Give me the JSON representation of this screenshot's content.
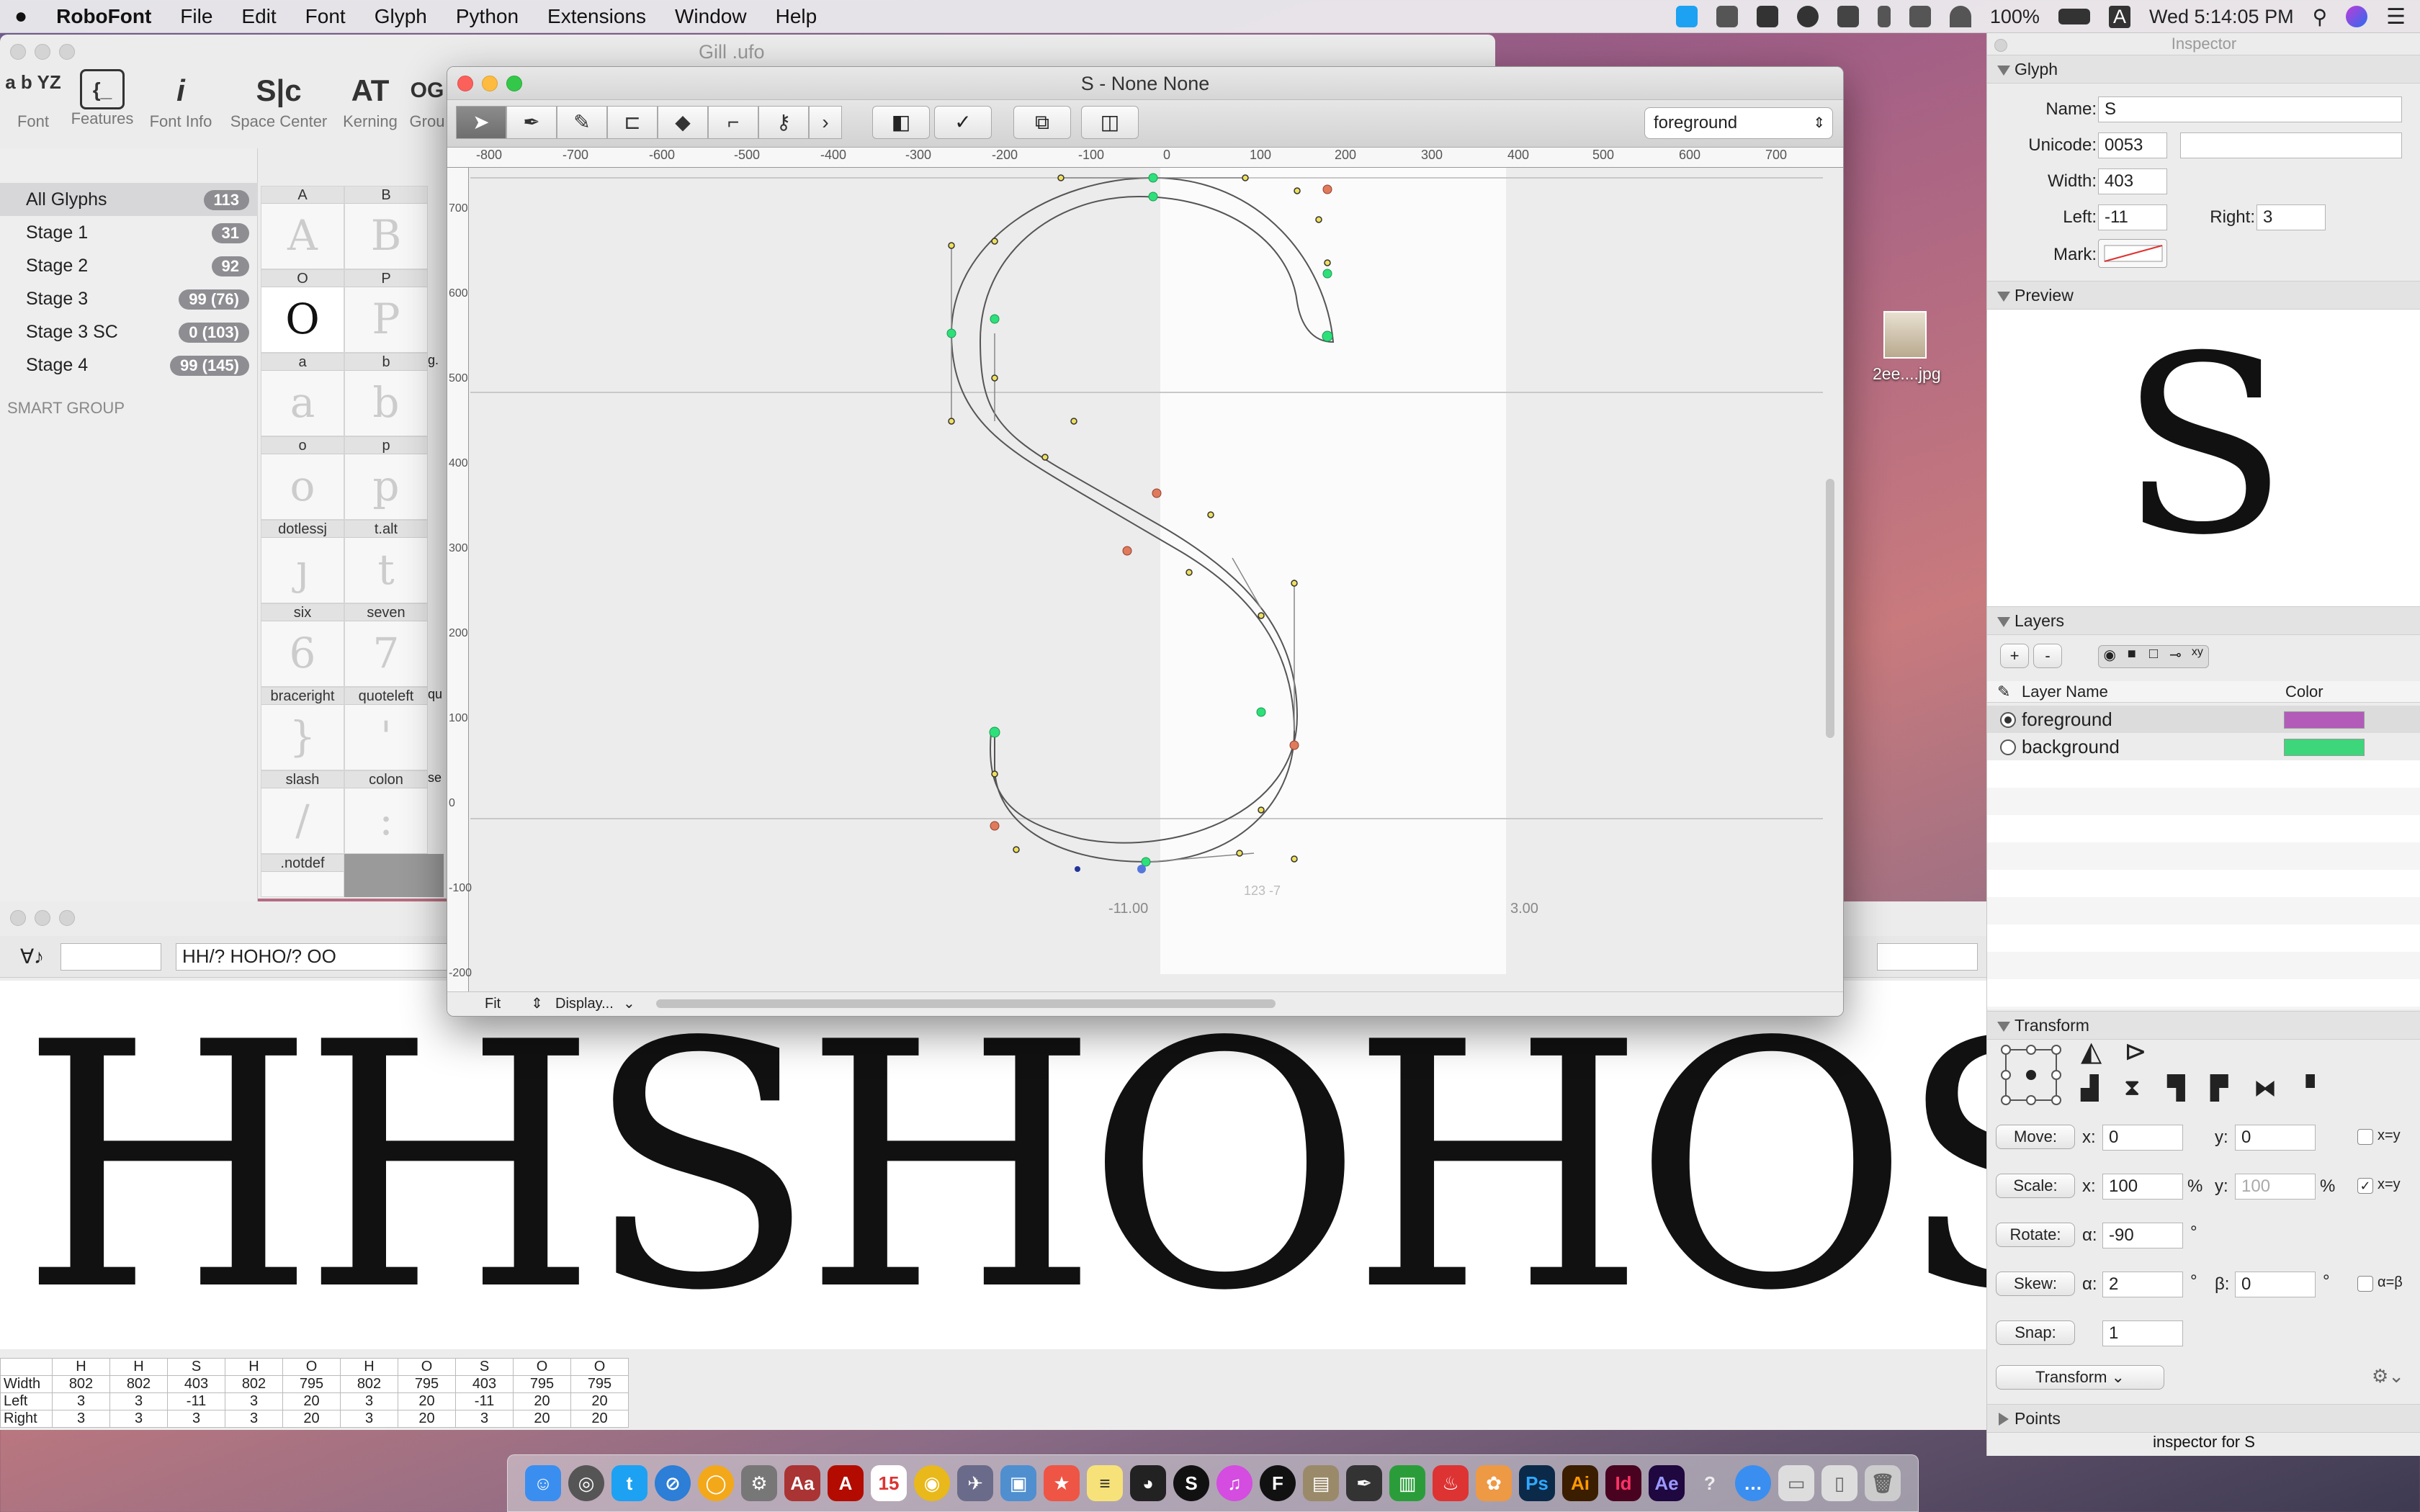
{
  "menubar": {
    "app": "RoboFont",
    "items": [
      "File",
      "Edit",
      "Font",
      "Glyph",
      "Python",
      "Extensions",
      "Window",
      "Help"
    ],
    "battery": "100%",
    "clock": "Wed 5:14:05 PM",
    "input_source": "A"
  },
  "font_window": {
    "title": "Gill .ufo",
    "toolbar": [
      {
        "label": "Font",
        "icon": "font-icon",
        "glyph": "a b YZ"
      },
      {
        "label": "Features",
        "icon": "features-icon",
        "glyph": "{_"
      },
      {
        "label": "Font Info",
        "icon": "info-icon",
        "glyph": "i"
      },
      {
        "label": "Space Center",
        "icon": "space-center-icon",
        "glyph": "S|c"
      },
      {
        "label": "Kerning",
        "icon": "kerning-icon",
        "glyph": "AT"
      },
      {
        "label": "Grou",
        "icon": "groups-icon",
        "glyph": "OG"
      }
    ],
    "smart_sets": [
      {
        "name": "All Glyphs",
        "count": "113"
      },
      {
        "name": "Stage 1",
        "count": "31"
      },
      {
        "name": "Stage 2",
        "count": "92"
      },
      {
        "name": "Stage 3",
        "count": "99 (76)"
      },
      {
        "name": "Stage 3 SC",
        "count": "0 (103)"
      },
      {
        "name": "Stage 4",
        "count": "99 (145)"
      }
    ],
    "smart_group_label": "SMART GROUP",
    "glyph_cells": [
      {
        "name": "A",
        "char": "A"
      },
      {
        "name": "B",
        "char": "B"
      },
      {
        "name": "O",
        "char": "O"
      },
      {
        "name": "P",
        "char": "P"
      },
      {
        "name": "a",
        "char": "a"
      },
      {
        "name": "b",
        "char": "b"
      },
      {
        "name": "o",
        "char": "o"
      },
      {
        "name": "p",
        "char": "p"
      },
      {
        "name": "dotlessj",
        "char": "ȷ"
      },
      {
        "name": "t.alt",
        "char": "t"
      },
      {
        "name": "six",
        "char": "6"
      },
      {
        "name": "seven",
        "char": "7"
      },
      {
        "name": "braceright",
        "char": "}"
      },
      {
        "name": "quoteleft",
        "char": "'"
      },
      {
        "name": "slash",
        "char": "/"
      },
      {
        "name": "colon",
        "char": ":"
      },
      {
        "name": ".notdef",
        "char": ""
      }
    ],
    "extra_col_headers": [
      "g.",
      "qu",
      "se"
    ]
  },
  "glyph_window": {
    "title": "S - None None",
    "layer_select": "foreground",
    "ruler_h": [
      "-800",
      "-700",
      "-600",
      "-500",
      "-400",
      "-300",
      "-200",
      "-100",
      "0",
      "100",
      "200",
      "300",
      "400",
      "500",
      "600",
      "700"
    ],
    "ruler_v": [
      "700",
      "600",
      "500",
      "400",
      "300",
      "200",
      "100",
      "0",
      "-100",
      "-200"
    ],
    "left_margin": "-11.00",
    "right_margin": "3.00",
    "coord_readout": "123 -7",
    "zoom": "Fit",
    "display": "Display..."
  },
  "space_center": {
    "text_input": "HH/? HOHO/? OO",
    "preview": "HHSHOHOSO",
    "table": {
      "rows": [
        "Width",
        "Left",
        "Right"
      ],
      "glyphs": [
        "H",
        "H",
        "S",
        "H",
        "O",
        "H",
        "O",
        "S",
        "O",
        "O"
      ],
      "width": [
        "802",
        "802",
        "403",
        "802",
        "795",
        "802",
        "795",
        "403",
        "795",
        "795"
      ],
      "left": [
        "3",
        "3",
        "-11",
        "3",
        "20",
        "3",
        "20",
        "-11",
        "20",
        "20"
      ],
      "right": [
        "3",
        "3",
        "3",
        "3",
        "20",
        "3",
        "20",
        "3",
        "20",
        "20"
      ]
    }
  },
  "desktop_icon": {
    "label": "2ee....jpg"
  },
  "inspector": {
    "title": "Inspector",
    "glyph_section": "Glyph",
    "name_label": "Name:",
    "name": "S",
    "unicode_label": "Unicode:",
    "unicode": "0053",
    "width_label": "Width:",
    "width": "403",
    "left_label": "Left:",
    "left": "-11",
    "right_label": "Right:",
    "right": "3",
    "mark_label": "Mark:",
    "preview_section": "Preview",
    "preview_char": "S",
    "layers_section": "Layers",
    "add": "+",
    "remove": "-",
    "col_name": "Layer Name",
    "col_color": "Color",
    "layers": [
      {
        "name": "foreground",
        "color": "#b35bb8",
        "active": true
      },
      {
        "name": "background",
        "color": "#3dd67a",
        "active": false
      }
    ],
    "transform_section": "Transform",
    "move_btn": "Move:",
    "move_x": "0",
    "move_y": "0",
    "scale_btn": "Scale:",
    "scale_x": "100",
    "scale_y": "100",
    "rotate_btn": "Rotate:",
    "rotate": "-90",
    "skew_btn": "Skew:",
    "skew_a": "2",
    "skew_b": "0",
    "snap_btn": "Snap:",
    "snap": "1",
    "transform_btn": "Transform",
    "x_label": "x:",
    "y_label": "y:",
    "alpha_label": "α:",
    "beta_label": "β:",
    "pct": "%",
    "deg": "°",
    "xy_label": "x=y",
    "ab_label": "α=β",
    "points_section": "Points",
    "footer": "inspector for S"
  },
  "colors": {
    "accent": "#b35bb8",
    "point_on": "#2ee07a",
    "point_off": "#f0e05a",
    "contour": "#555555"
  }
}
